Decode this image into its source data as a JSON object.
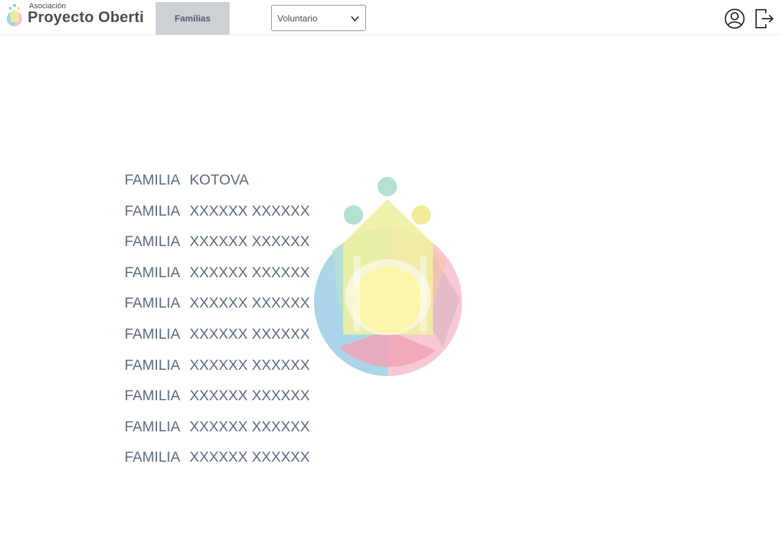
{
  "header": {
    "logo": {
      "small_text": "Asociación",
      "brand_text": "Proyecto Oberti"
    },
    "nav_tab_label": "Familias",
    "role_select": {
      "value": "Voluntario"
    },
    "icons": {
      "profile": "user-circle-icon",
      "logout": "logout-icon"
    }
  },
  "families": [
    {
      "prefix": "FAMILIA",
      "name": "KOTOVA"
    },
    {
      "prefix": "FAMILIA",
      "name": "XXXXXX XXXXXX"
    },
    {
      "prefix": "FAMILIA",
      "name": "XXXXXX XXXXXX"
    },
    {
      "prefix": "FAMILIA",
      "name": "XXXXXX XXXXXX"
    },
    {
      "prefix": "FAMILIA",
      "name": "XXXXXX XXXXXX"
    },
    {
      "prefix": "FAMILIA",
      "name": "XXXXXX XXXXXX"
    },
    {
      "prefix": "FAMILIA",
      "name": "XXXXXX XXXXXX"
    },
    {
      "prefix": "FAMILIA",
      "name": "XXXXXX XXXXXX"
    },
    {
      "prefix": "FAMILIA",
      "name": "XXXXXX XXXXXX"
    },
    {
      "prefix": "FAMILIA",
      "name": "XXXXXX XXXXXX"
    }
  ],
  "colors": {
    "list_text": "#5a6b7f",
    "nav_tab_bg": "#cdd1d5"
  }
}
